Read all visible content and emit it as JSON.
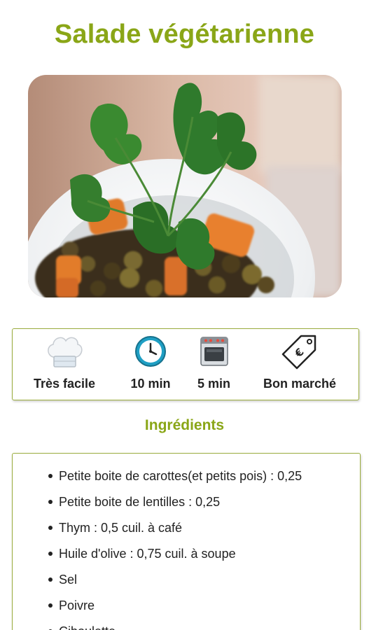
{
  "recipe": {
    "title": "Salade végétarienne",
    "image_alt": "Salade de lentilles aux carottes et persil"
  },
  "info": [
    {
      "icon": "chef-hat-icon",
      "label": "Très facile"
    },
    {
      "icon": "clock-icon",
      "label": "10 min"
    },
    {
      "icon": "oven-icon",
      "label": "5 min"
    },
    {
      "icon": "price-tag-icon",
      "label": "Bon marché"
    }
  ],
  "ingredients": {
    "title": "Ingrédients",
    "items": [
      "Petite boite de carottes(et petits pois)  : 0,25",
      "Petite boite de lentilles  : 0,25",
      "Thym  : 0,5 cuil. à café",
      "Huile d'olive  : 0,75 cuil. à soupe",
      "Sel",
      "Poivre",
      "Ciboulette"
    ]
  },
  "colors": {
    "accent": "#8aa617",
    "border": "#9aac3d"
  }
}
